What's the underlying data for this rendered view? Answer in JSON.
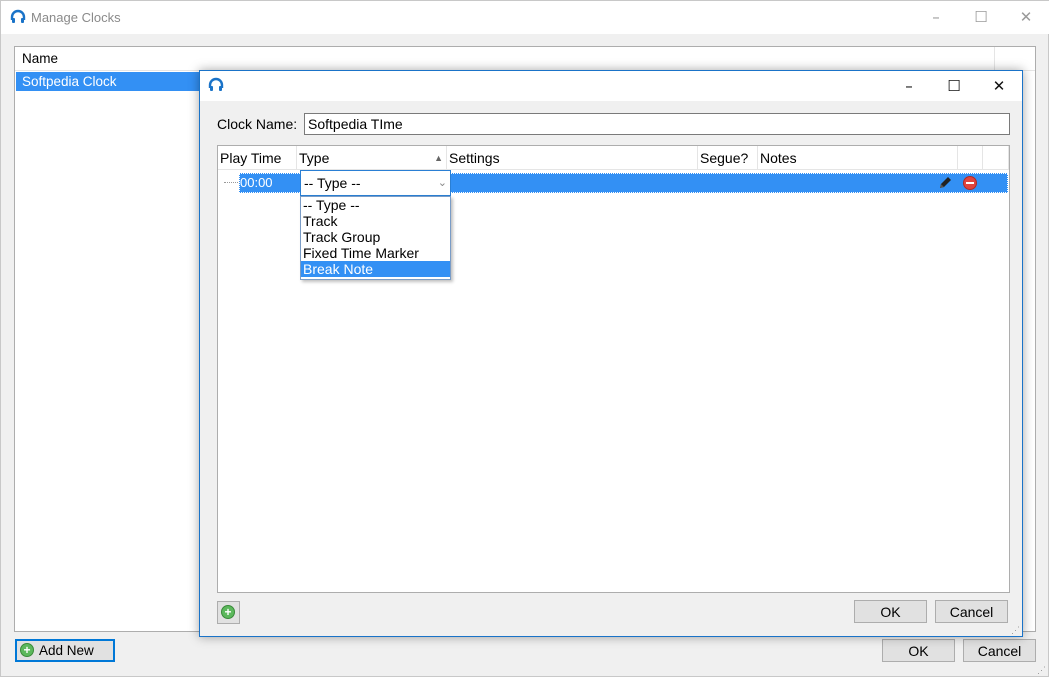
{
  "outer_window": {
    "title": "Manage Clocks",
    "controls": {
      "minimize": "–",
      "maximize": "☐",
      "close": "✕"
    },
    "list": {
      "header": "Name",
      "rows": [
        "Softpedia Clock"
      ]
    },
    "add_new_label": "Add New",
    "ok_label": "OK",
    "cancel_label": "Cancel"
  },
  "dialog": {
    "controls": {
      "minimize": "–",
      "maximize": "☐",
      "close": "✕"
    },
    "clock_name_label": "Clock Name:",
    "clock_name_value": "Softpedia TIme",
    "columns": [
      "Play Time",
      "Type",
      "Settings",
      "Segue?",
      "Notes"
    ],
    "row": {
      "play_time": "00:00",
      "type": "-- Type --"
    },
    "type_options": [
      "-- Type --",
      "Track",
      "Track Group",
      "Fixed Time Marker",
      "Break Note"
    ],
    "type_highlighted": "Break Note",
    "ok_label": "OK",
    "cancel_label": "Cancel"
  },
  "colors": {
    "accent": "#0078d7",
    "selection": "#3390f4",
    "add_icon": "#5cb85c",
    "delete_icon": "#e0443e"
  }
}
